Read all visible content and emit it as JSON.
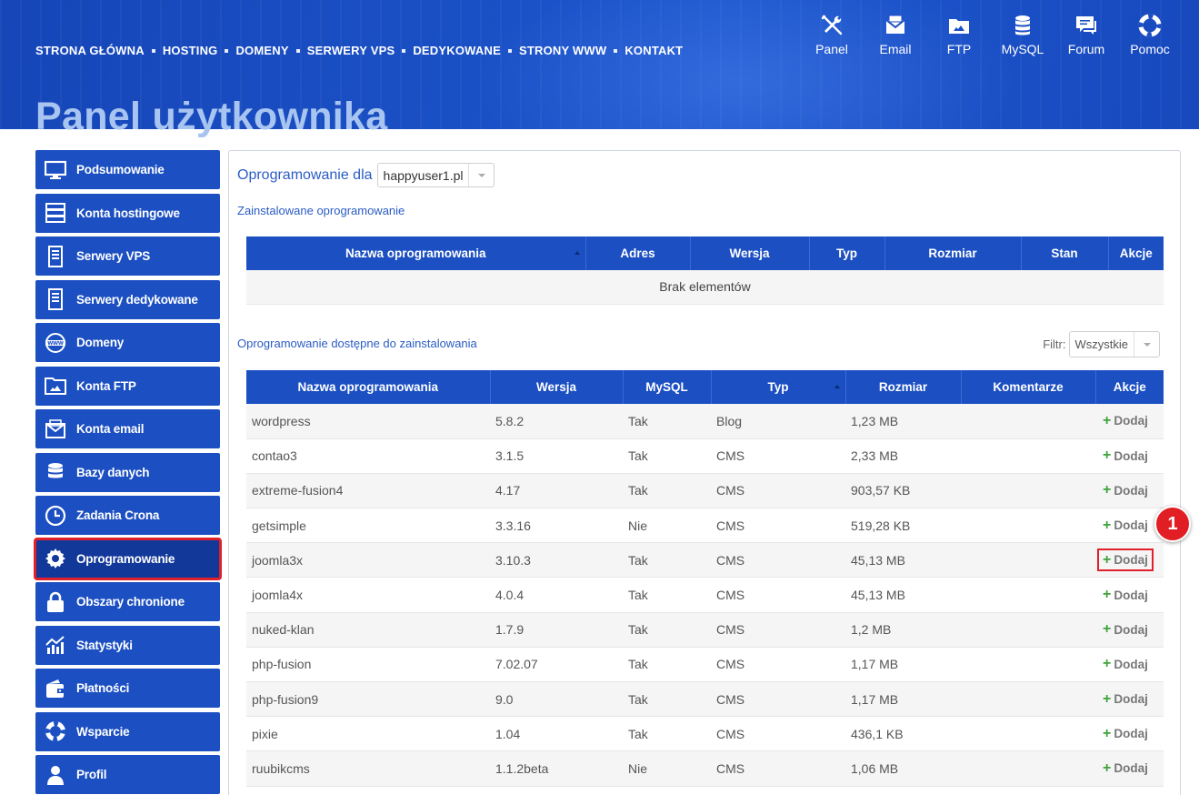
{
  "topnav": [
    "STRONA GŁÓWNA",
    "HOSTING",
    "DOMENY",
    "SERWERY VPS",
    "DEDYKOWANE",
    "STRONY WWW",
    "KONTAKT"
  ],
  "icon_nav": [
    {
      "label": "Panel",
      "icon": "tools-icon"
    },
    {
      "label": "Email",
      "icon": "envelope-icon"
    },
    {
      "label": "FTP",
      "icon": "folder-icon"
    },
    {
      "label": "MySQL",
      "icon": "database-icon"
    },
    {
      "label": "Forum",
      "icon": "chat-icon"
    },
    {
      "label": "Pomoc",
      "icon": "lifebuoy-icon"
    }
  ],
  "page_title": "Panel użytkownika",
  "sidebar": [
    {
      "label": "Podsumowanie",
      "icon": "monitor-icon"
    },
    {
      "label": "Konta hostingowe",
      "icon": "server-icon"
    },
    {
      "label": "Serwery VPS",
      "icon": "server-tower-icon"
    },
    {
      "label": "Serwery dedykowane",
      "icon": "server-tower-icon"
    },
    {
      "label": "Domeny",
      "icon": "globe-www-icon"
    },
    {
      "label": "Konta FTP",
      "icon": "folder-icon"
    },
    {
      "label": "Konta email",
      "icon": "envelope-icon"
    },
    {
      "label": "Bazy danych",
      "icon": "database-icon"
    },
    {
      "label": "Zadania Crona",
      "icon": "clock-icon"
    },
    {
      "label": "Oprogramowanie",
      "icon": "gear-icon",
      "active": true
    },
    {
      "label": "Obszary chronione",
      "icon": "lock-icon"
    },
    {
      "label": "Statystyki",
      "icon": "chart-icon"
    },
    {
      "label": "Płatności",
      "icon": "wallet-icon"
    },
    {
      "label": "Wsparcie",
      "icon": "lifebuoy-icon"
    },
    {
      "label": "Profil",
      "icon": "user-icon"
    }
  ],
  "main": {
    "for_label": "Oprogramowanie dla",
    "domain_select": "happyuser1.pl",
    "installed_label": "Zainstalowane oprogramowanie",
    "installed_headers": [
      "Nazwa oprogramowania",
      "Adres",
      "Wersja",
      "Typ",
      "Rozmiar",
      "Stan",
      "Akcje"
    ],
    "installed_empty": "Brak elementów",
    "available_label": "Oprogramowanie dostępne do zainstalowania",
    "filter_label": "Filtr:",
    "filter_value": "Wszystkie",
    "available_headers": [
      "Nazwa oprogramowania",
      "Wersja",
      "MySQL",
      "Typ",
      "Rozmiar",
      "Komentarze",
      "Akcje"
    ],
    "add_label": "Dodaj",
    "rows": [
      {
        "name": "wordpress",
        "version": "5.8.2",
        "mysql": "Tak",
        "type": "Blog",
        "size": "1,23 MB",
        "comment": ""
      },
      {
        "name": "contao3",
        "version": "3.1.5",
        "mysql": "Tak",
        "type": "CMS",
        "size": "2,33 MB",
        "comment": ""
      },
      {
        "name": "extreme-fusion4",
        "version": "4.17",
        "mysql": "Tak",
        "type": "CMS",
        "size": "903,57 KB",
        "comment": ""
      },
      {
        "name": "getsimple",
        "version": "3.3.16",
        "mysql": "Nie",
        "type": "CMS",
        "size": "519,28 KB",
        "comment": ""
      },
      {
        "name": "joomla3x",
        "version": "3.10.3",
        "mysql": "Tak",
        "type": "CMS",
        "size": "45,13 MB",
        "comment": "",
        "highlight": true
      },
      {
        "name": "joomla4x",
        "version": "4.0.4",
        "mysql": "Tak",
        "type": "CMS",
        "size": "45,13 MB",
        "comment": ""
      },
      {
        "name": "nuked-klan",
        "version": "1.7.9",
        "mysql": "Tak",
        "type": "CMS",
        "size": "1,2 MB",
        "comment": ""
      },
      {
        "name": "php-fusion",
        "version": "7.02.07",
        "mysql": "Tak",
        "type": "CMS",
        "size": "1,17 MB",
        "comment": ""
      },
      {
        "name": "php-fusion9",
        "version": "9.0",
        "mysql": "Tak",
        "type": "CMS",
        "size": "1,17 MB",
        "comment": ""
      },
      {
        "name": "pixie",
        "version": "1.04",
        "mysql": "Tak",
        "type": "CMS",
        "size": "436,1 KB",
        "comment": ""
      },
      {
        "name": "ruubikcms",
        "version": "1.1.2beta",
        "mysql": "Nie",
        "type": "CMS",
        "size": "1,06 MB",
        "comment": ""
      }
    ]
  },
  "callout_badge": "1",
  "colors": {
    "brand_blue": "#1b4fc2",
    "active_blue": "#12389a",
    "highlight_red": "#e0202a",
    "add_green": "#3fa33a"
  }
}
